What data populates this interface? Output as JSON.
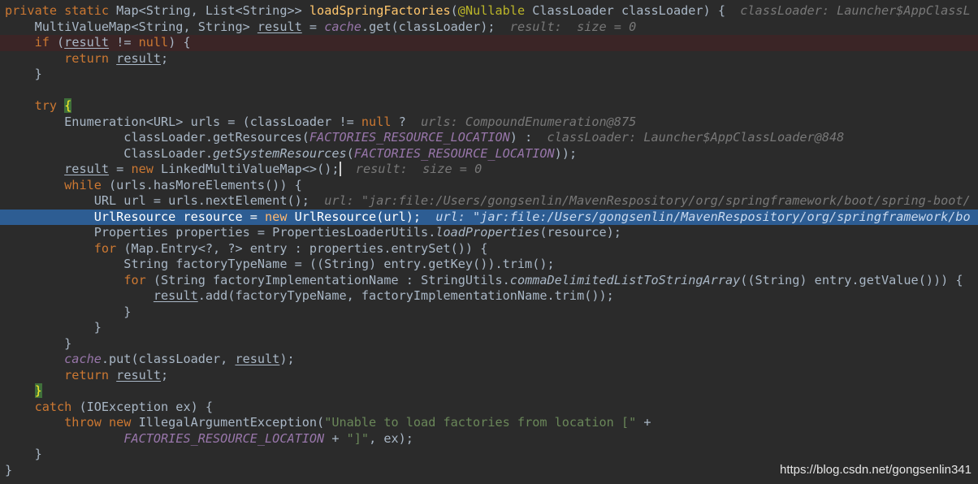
{
  "watermark": "https://blog.csdn.net/gongsenlin341",
  "colors": {
    "background": "#2b2b2b",
    "keyword": "#cc7832",
    "method_declaration": "#ffc66d",
    "annotation": "#bbb529",
    "static_field": "#9876aa",
    "string": "#6a8759",
    "inline_debug_hint": "#787878",
    "execution_line": "#2d5d93",
    "breakpoint_line": "#3b2526"
  },
  "code_lines": [
    {
      "kind": "normal",
      "tokens": [
        {
          "t": "private static ",
          "c": "kw"
        },
        {
          "t": "Map<String, List<String>> ",
          "c": ""
        },
        {
          "t": "loadSpringFactories",
          "c": "fn"
        },
        {
          "t": "(",
          "c": ""
        },
        {
          "t": "@Nullable ",
          "c": "ann"
        },
        {
          "t": "ClassLoader classLoader) {  ",
          "c": ""
        },
        {
          "t": "classLoader: Launcher$AppClassL",
          "c": "hint"
        }
      ]
    },
    {
      "kind": "normal",
      "tokens": [
        {
          "t": "    MultiValueMap<String, String> ",
          "c": ""
        },
        {
          "t": "result",
          "c": "ul"
        },
        {
          "t": " = ",
          "c": ""
        },
        {
          "t": "cache",
          "c": "field"
        },
        {
          "t": ".get(classLoader);  ",
          "c": ""
        },
        {
          "t": "result:  size = 0",
          "c": "hint"
        }
      ]
    },
    {
      "kind": "bp",
      "tokens": [
        {
          "t": "    ",
          "c": ""
        },
        {
          "t": "if",
          "c": "kw"
        },
        {
          "t": " (",
          "c": ""
        },
        {
          "t": "result",
          "c": "ul"
        },
        {
          "t": " != ",
          "c": ""
        },
        {
          "t": "null",
          "c": "kw"
        },
        {
          "t": ") {",
          "c": ""
        }
      ]
    },
    {
      "kind": "normal",
      "tokens": [
        {
          "t": "        ",
          "c": ""
        },
        {
          "t": "return ",
          "c": "kw"
        },
        {
          "t": "result",
          "c": "ul"
        },
        {
          "t": ";",
          "c": ""
        }
      ]
    },
    {
      "kind": "normal",
      "tokens": [
        {
          "t": "    }",
          "c": ""
        }
      ]
    },
    {
      "kind": "normal",
      "tokens": [
        {
          "t": "",
          "c": ""
        }
      ]
    },
    {
      "kind": "normal",
      "tokens": [
        {
          "t": "    ",
          "c": ""
        },
        {
          "t": "try ",
          "c": "kw"
        },
        {
          "t": "{",
          "c": "brmatch"
        }
      ]
    },
    {
      "kind": "normal",
      "tokens": [
        {
          "t": "        Enumeration<URL> urls = (classLoader != ",
          "c": ""
        },
        {
          "t": "null",
          "c": "kw"
        },
        {
          "t": " ?  ",
          "c": ""
        },
        {
          "t": "urls: CompoundEnumeration@875",
          "c": "hint"
        }
      ]
    },
    {
      "kind": "normal",
      "tokens": [
        {
          "t": "                classLoader.getResources(",
          "c": ""
        },
        {
          "t": "FACTORIES_RESOURCE_LOCATION",
          "c": "const"
        },
        {
          "t": ") :  ",
          "c": ""
        },
        {
          "t": "classLoader: Launcher$AppClassLoader@848",
          "c": "hint"
        }
      ]
    },
    {
      "kind": "normal",
      "tokens": [
        {
          "t": "                ClassLoader.",
          "c": ""
        },
        {
          "t": "getSystemResources",
          "c": "ital"
        },
        {
          "t": "(",
          "c": ""
        },
        {
          "t": "FACTORIES_RESOURCE_LOCATION",
          "c": "const"
        },
        {
          "t": "));",
          "c": ""
        }
      ]
    },
    {
      "kind": "normal",
      "tokens": [
        {
          "t": "        ",
          "c": ""
        },
        {
          "t": "result",
          "c": "ul"
        },
        {
          "t": " = ",
          "c": ""
        },
        {
          "t": "new ",
          "c": "kw"
        },
        {
          "t": "LinkedMultiValueMap<>();",
          "c": ""
        },
        {
          "t": "  ",
          "c": "caret"
        },
        {
          "t": "result:  size = 0",
          "c": "hint"
        }
      ]
    },
    {
      "kind": "normal",
      "tokens": [
        {
          "t": "        ",
          "c": ""
        },
        {
          "t": "while",
          "c": "kw"
        },
        {
          "t": " (urls.hasMoreElements()) {",
          "c": ""
        }
      ]
    },
    {
      "kind": "normal",
      "tokens": [
        {
          "t": "            URL url = urls.nextElement();  ",
          "c": ""
        },
        {
          "t": "url: \"jar:file:/Users/gongsenlin/MavenRespository/org/springframework/boot/spring-boot/",
          "c": "hint"
        }
      ]
    },
    {
      "kind": "exec",
      "tokens": [
        {
          "t": "            UrlResource resource = ",
          "c": ""
        },
        {
          "t": "new ",
          "c": "kw"
        },
        {
          "t": "UrlResource(url);  ",
          "c": ""
        },
        {
          "t": "url: \"jar:file:/Users/gongsenlin/MavenRespository/org/springframework/bo",
          "c": "hint"
        }
      ]
    },
    {
      "kind": "normal",
      "tokens": [
        {
          "t": "            Properties properties = PropertiesLoaderUtils.",
          "c": ""
        },
        {
          "t": "loadProperties",
          "c": "ital"
        },
        {
          "t": "(resource);",
          "c": ""
        }
      ]
    },
    {
      "kind": "normal",
      "tokens": [
        {
          "t": "            ",
          "c": ""
        },
        {
          "t": "for",
          "c": "kw"
        },
        {
          "t": " (Map.Entry<?, ?> entry : properties.entrySet()) {",
          "c": ""
        }
      ]
    },
    {
      "kind": "normal",
      "tokens": [
        {
          "t": "                String factoryTypeName = ((String) entry.getKey()).trim();",
          "c": ""
        }
      ]
    },
    {
      "kind": "normal",
      "tokens": [
        {
          "t": "                ",
          "c": ""
        },
        {
          "t": "for",
          "c": "kw"
        },
        {
          "t": " (String factoryImplementationName : StringUtils.",
          "c": ""
        },
        {
          "t": "commaDelimitedListToStringArray",
          "c": "ital"
        },
        {
          "t": "((String) entry.getValue())) {",
          "c": ""
        }
      ]
    },
    {
      "kind": "normal",
      "tokens": [
        {
          "t": "                    ",
          "c": ""
        },
        {
          "t": "result",
          "c": "ul"
        },
        {
          "t": ".add(factoryTypeName, factoryImplementationName.trim());",
          "c": ""
        }
      ]
    },
    {
      "kind": "normal",
      "tokens": [
        {
          "t": "                }",
          "c": ""
        }
      ]
    },
    {
      "kind": "normal",
      "tokens": [
        {
          "t": "            }",
          "c": ""
        }
      ]
    },
    {
      "kind": "normal",
      "tokens": [
        {
          "t": "        }",
          "c": ""
        }
      ]
    },
    {
      "kind": "normal",
      "tokens": [
        {
          "t": "        ",
          "c": ""
        },
        {
          "t": "cache",
          "c": "field"
        },
        {
          "t": ".put(classLoader, ",
          "c": ""
        },
        {
          "t": "result",
          "c": "ul"
        },
        {
          "t": ");",
          "c": ""
        }
      ]
    },
    {
      "kind": "normal",
      "tokens": [
        {
          "t": "        ",
          "c": ""
        },
        {
          "t": "return ",
          "c": "kw"
        },
        {
          "t": "result",
          "c": "ul"
        },
        {
          "t": ";",
          "c": ""
        }
      ]
    },
    {
      "kind": "normal",
      "tokens": [
        {
          "t": "    ",
          "c": ""
        },
        {
          "t": "}",
          "c": "brmatch"
        }
      ]
    },
    {
      "kind": "normal",
      "tokens": [
        {
          "t": "    ",
          "c": ""
        },
        {
          "t": "catch",
          "c": "kw"
        },
        {
          "t": " (IOException ex) {",
          "c": ""
        }
      ]
    },
    {
      "kind": "normal",
      "tokens": [
        {
          "t": "        ",
          "c": ""
        },
        {
          "t": "throw new ",
          "c": "kw"
        },
        {
          "t": "IllegalArgumentException(",
          "c": ""
        },
        {
          "t": "\"Unable to load factories from location [\"",
          "c": "str"
        },
        {
          "t": " +",
          "c": ""
        }
      ]
    },
    {
      "kind": "normal",
      "tokens": [
        {
          "t": "                ",
          "c": ""
        },
        {
          "t": "FACTORIES_RESOURCE_LOCATION",
          "c": "const"
        },
        {
          "t": " + ",
          "c": ""
        },
        {
          "t": "\"]\"",
          "c": "str"
        },
        {
          "t": ", ex);",
          "c": ""
        }
      ]
    },
    {
      "kind": "normal",
      "tokens": [
        {
          "t": "    }",
          "c": ""
        }
      ]
    },
    {
      "kind": "normal",
      "tokens": [
        {
          "t": "}",
          "c": ""
        }
      ]
    }
  ]
}
